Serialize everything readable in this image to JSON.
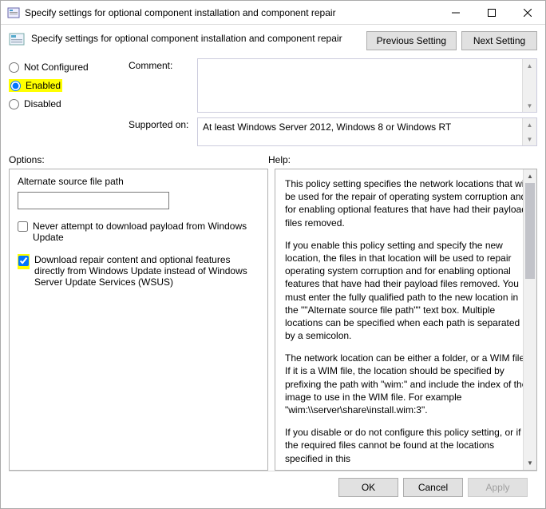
{
  "titlebar": {
    "title": "Specify settings for optional component installation and component repair"
  },
  "header": {
    "title": "Specify settings for optional component installation and component repair",
    "prev": "Previous Setting",
    "next": "Next Setting"
  },
  "radios": {
    "not_configured": "Not Configured",
    "enabled": "Enabled",
    "disabled": "Disabled",
    "selected": "enabled"
  },
  "fields": {
    "comment_label": "Comment:",
    "comment_value": "",
    "supported_label": "Supported on:",
    "supported_value": "At least Windows Server 2012, Windows 8 or Windows RT"
  },
  "section_labels": {
    "options": "Options:",
    "help": "Help:"
  },
  "options": {
    "alt_path_label": "Alternate source file path",
    "alt_path_value": "",
    "cb1_label": "Never attempt to download payload from Windows Update",
    "cb1_checked": false,
    "cb2_label": "Download repair content and optional features directly from Windows Update instead of Windows Server Update Services (WSUS)",
    "cb2_checked": true
  },
  "help": {
    "p1": "This policy setting specifies the network locations that will be used for the repair of operating system corruption and for enabling optional features that have had their payload files removed.",
    "p2": "If you enable this policy setting and specify the new location, the files in that location will be used to repair operating system corruption and for enabling optional features that have had their payload files removed. You must enter the fully qualified path to the new location in the \"\"Alternate source file path\"\" text box. Multiple locations can be specified when each path is separated by a semicolon.",
    "p3": "The network location can be either a folder, or a WIM file. If it is a WIM file, the location should be specified by prefixing the path with \"wim:\" and include the index of the image to use in the WIM file. For example \"wim:\\\\server\\share\\install.wim:3\".",
    "p4": "If you disable or do not configure this policy setting, or if the required files cannot be found at the locations specified in this"
  },
  "footer": {
    "ok": "OK",
    "cancel": "Cancel",
    "apply": "Apply"
  }
}
